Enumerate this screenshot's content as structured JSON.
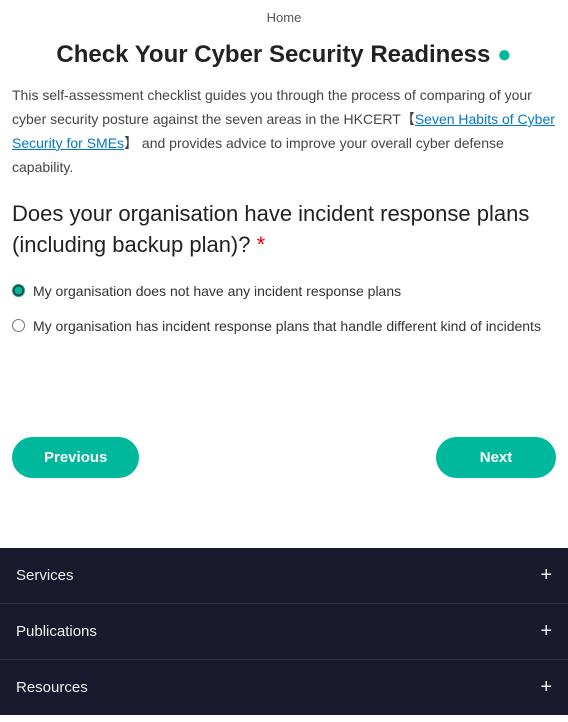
{
  "breadcrumb": {
    "home": "Home"
  },
  "header": {
    "title": "Check Your Cyber Security Readiness",
    "dot": "●"
  },
  "description": {
    "text_before_link": "This self-assessment checklist guides you through the process of comparing of your cyber security posture against the seven areas in the HKCERT【",
    "link_text": "Seven Habits of Cyber Security for SMEs",
    "text_after_link": "】 and provides advice to improve your overall cyber defense capability."
  },
  "question": {
    "text": "Does your organisation have incident response plans (including backup plan)?",
    "required_marker": " *",
    "options": [
      {
        "id": "opt1",
        "label": "My organisation does not have any incident response plans",
        "checked": true
      },
      {
        "id": "opt2",
        "label": "My organisation has incident response plans that handle different kind of incidents",
        "checked": false
      }
    ]
  },
  "navigation": {
    "previous_label": "Previous",
    "next_label": "Next"
  },
  "footer": {
    "items": [
      {
        "label": "Services",
        "icon": "plus"
      },
      {
        "label": "Publications",
        "icon": "plus"
      },
      {
        "label": "Resources",
        "icon": "plus"
      }
    ]
  }
}
